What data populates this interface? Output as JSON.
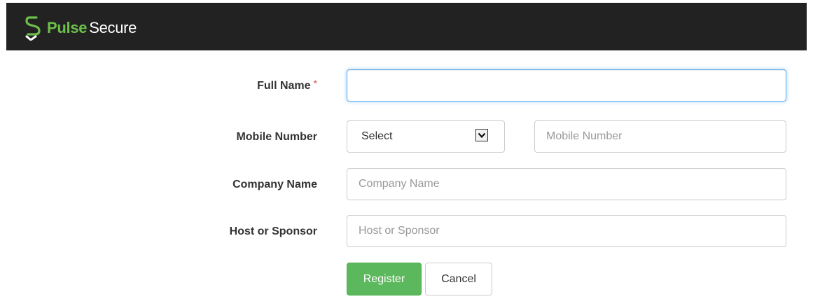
{
  "header": {
    "brand_primary": "Pulse",
    "brand_secondary": "Secure",
    "brand_color": "#6cc04a",
    "background_color": "#222222"
  },
  "form": {
    "full_name": {
      "label": "Full Name",
      "required_marker": "*",
      "value": "",
      "placeholder": ""
    },
    "mobile_number": {
      "label": "Mobile Number",
      "country_select": "Select",
      "placeholder": "Mobile Number",
      "value": ""
    },
    "company_name": {
      "label": "Company Name",
      "placeholder": "Company Name",
      "value": ""
    },
    "host_or_sponsor": {
      "label": "Host or Sponsor",
      "placeholder": "Host or Sponsor",
      "value": ""
    }
  },
  "actions": {
    "register_label": "Register",
    "register_color": "#5cb85c",
    "cancel_label": "Cancel"
  }
}
